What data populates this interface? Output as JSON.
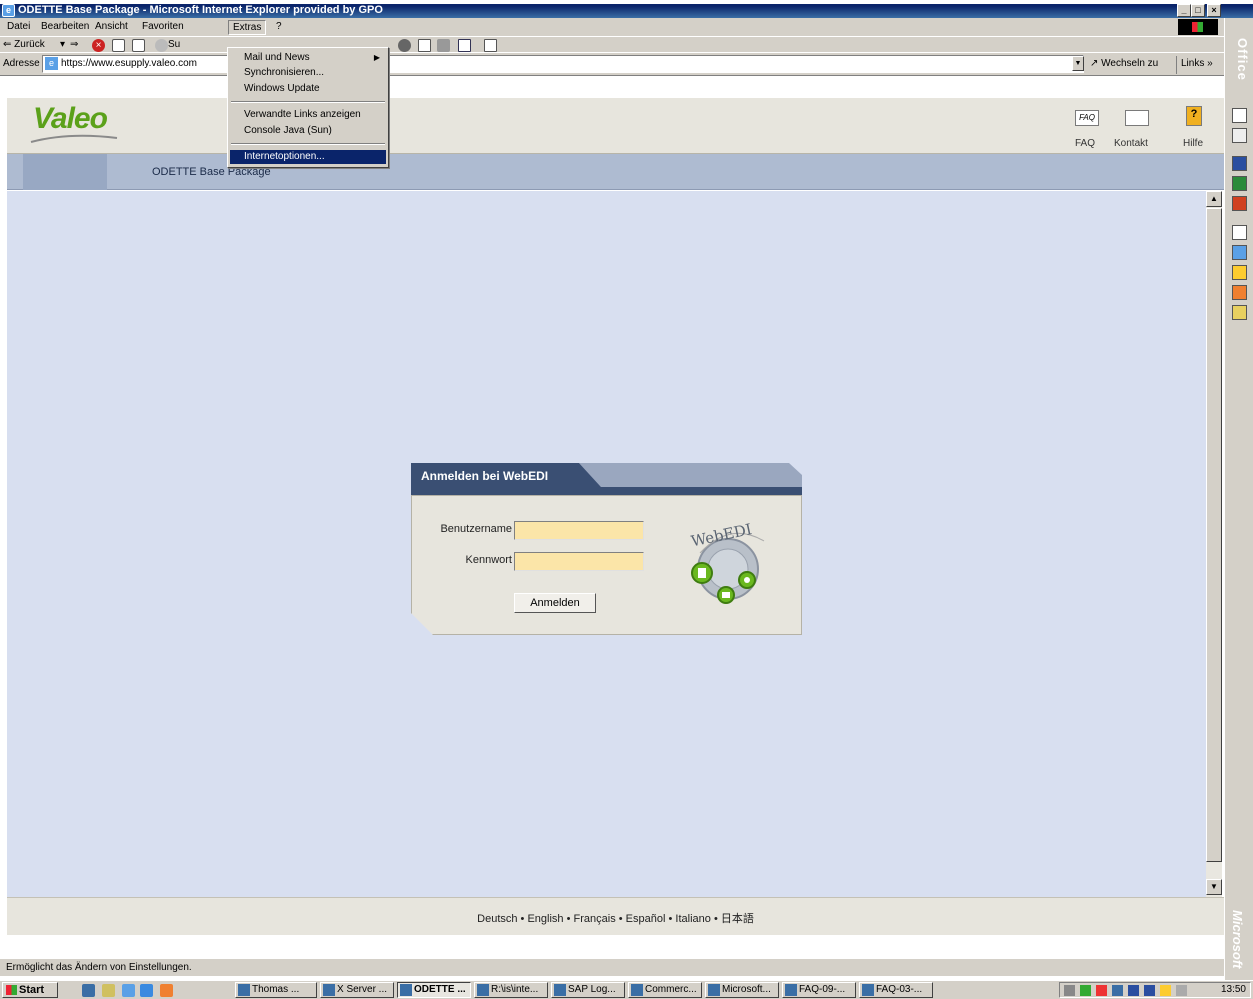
{
  "window": {
    "title": "ODETTE Base Package - Microsoft Internet Explorer provided by GPO",
    "min": "_",
    "max": "□",
    "close": "×"
  },
  "menubar": {
    "items": [
      "Datei",
      "Bearbeiten",
      "Ansicht",
      "Favoriten",
      "Extras",
      "?"
    ]
  },
  "extras_menu": {
    "items": [
      {
        "label": "Mail und News",
        "submenu": "▶"
      },
      {
        "label": "Synchronisieren..."
      },
      {
        "label": "Windows Update"
      },
      {
        "label": "Verwandte Links anzeigen"
      },
      {
        "label": "Console Java (Sun)"
      },
      {
        "label": "Internetoptionen..."
      }
    ]
  },
  "toolbar": {
    "back": "⇐ Zurück",
    "back_drop": "▾",
    "forward": "⇒",
    "search_partial": "Su"
  },
  "addressbar": {
    "label": "Adresse",
    "url": "https://www.esupply.valeo.com",
    "go": "Wechseln zu",
    "links": "Links »"
  },
  "site": {
    "logo": "Valeo",
    "faq_icon": "FAQ",
    "faq": "FAQ",
    "kontakt": "Kontakt",
    "hilfe": "Hilfe",
    "hilfe_icon": "?",
    "package_title": "ODETTE Base Package"
  },
  "login": {
    "title": "Anmelden bei WebEDI",
    "username_label": "Benutzername",
    "username_value": "",
    "password_label": "Kennwort",
    "password_value": "",
    "submit": "Anmelden",
    "logo_text": "WebEDI"
  },
  "footer": {
    "languages": [
      "Deutsch",
      "English",
      "Français",
      "Español",
      "Italiano",
      "日本語"
    ],
    "separator": " • "
  },
  "statusbar": {
    "text": "Ermöglicht das Ändern von Einstellungen."
  },
  "taskbar": {
    "start": "Start",
    "tasks": [
      {
        "label": "Thomas ...",
        "active": false
      },
      {
        "label": "X Server ...",
        "active": false
      },
      {
        "label": "ODETTE ...",
        "active": true
      },
      {
        "label": "R:\\is\\inte...",
        "active": false
      },
      {
        "label": "SAP Log...",
        "active": false
      },
      {
        "label": "Commerc...",
        "active": false
      },
      {
        "label": "Microsoft...",
        "active": false
      },
      {
        "label": "FAQ-09-...",
        "active": false
      },
      {
        "label": "FAQ-03-...",
        "active": false
      }
    ],
    "clock": "13:50"
  },
  "officebar": {
    "label": "Office",
    "vendor": "Microsoft"
  },
  "colors": {
    "accent_navy": "#3a4f73",
    "valeo_green": "#5ba11a",
    "input_fill": "#fbe5a8",
    "menu_highlight": "#0a246a"
  }
}
